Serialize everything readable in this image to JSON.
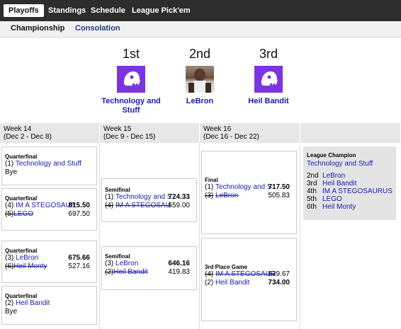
{
  "nav": {
    "tabs": [
      "Playoffs",
      "Standings",
      "Schedule",
      "League Pick'em"
    ],
    "active": "Playoffs"
  },
  "subnav": {
    "tabs": [
      "Championship",
      "Consolation"
    ],
    "active": "Championship"
  },
  "podium": [
    {
      "place": "1st",
      "name_line1": "Technology and",
      "name_line2": "Stuff",
      "avatar": "helmet-icon"
    },
    {
      "place": "2nd",
      "name_line1": "LeBron",
      "name_line2": "",
      "avatar": "user-photo"
    },
    {
      "place": "3rd",
      "name_line1": "Heil Bandit",
      "name_line2": "",
      "avatar": "helmet-icon"
    }
  ],
  "weeks": [
    {
      "title": "Week 14",
      "dates": "(Dec 2 - Dec 8)"
    },
    {
      "title": "Week 15",
      "dates": "(Dec 9 - Dec 15)"
    },
    {
      "title": "Week 16",
      "dates": "(Dec 16 - Dec 22)"
    }
  ],
  "matchups": {
    "qf1": {
      "title": "Quarterfinal",
      "seed": "(1)",
      "team": "Technology and Stuff",
      "bye": "Bye"
    },
    "qf2": {
      "title": "Quarterfinal",
      "a_seed": "(4)",
      "a_team": "IM A STEGOSAUR",
      "a_score": "815.50",
      "b_seed": "(5)",
      "b_team": "LEGO",
      "b_score": "697.50"
    },
    "qf3": {
      "title": "Quarterfinal",
      "a_seed": "(3)",
      "a_team": "LeBron",
      "a_score": "675.66",
      "b_seed": "(6)",
      "b_team": "Heil Monty",
      "b_score": "527.16"
    },
    "qf4": {
      "title": "Quarterfinal",
      "seed": "(2)",
      "team": "Heil Bandit",
      "bye": "Bye"
    },
    "sf1": {
      "title": "Semifinal",
      "a_seed": "(1)",
      "a_team": "Technology and Stu",
      "a_score": "724.33",
      "b_seed": "(4)",
      "b_team": "IM A STEGOSAUR",
      "b_score": "559.00"
    },
    "sf2": {
      "title": "Semifinal",
      "a_seed": "(3)",
      "a_team": "LeBron",
      "a_score": "646.16",
      "b_seed": "(2)",
      "b_team": "Heil Bandit",
      "b_score": "419.83"
    },
    "final": {
      "title": "Final",
      "a_seed": "(1)",
      "a_team": "Technology and Stu",
      "a_score": "717.50",
      "b_seed": "(3)",
      "b_team": "LeBron",
      "b_score": "505.83"
    },
    "third": {
      "title": "3rd Place Game",
      "a_seed": "(4)",
      "a_team": "IM A STEGOSAUR",
      "a_score": "529.67",
      "b_seed": "(2)",
      "b_team": "Heil Bandit",
      "b_score": "734.00"
    }
  },
  "champion": {
    "title": "League Champion",
    "team": "Technology and Stuff",
    "places": [
      {
        "rank": "2nd",
        "team": "LeBron"
      },
      {
        "rank": "3rd",
        "team": "Heil Bandit"
      },
      {
        "rank": "4th",
        "team": "IM A STEGOSAURUS"
      },
      {
        "rank": "5th",
        "team": "LEGO"
      },
      {
        "rank": "6th",
        "team": "Heil Monty"
      }
    ]
  },
  "colors": {
    "link": "#1a1ab0",
    "nav_bg": "#2d2d2d",
    "helmet": "#7b35e0",
    "header_bg": "#e7e7e7"
  }
}
